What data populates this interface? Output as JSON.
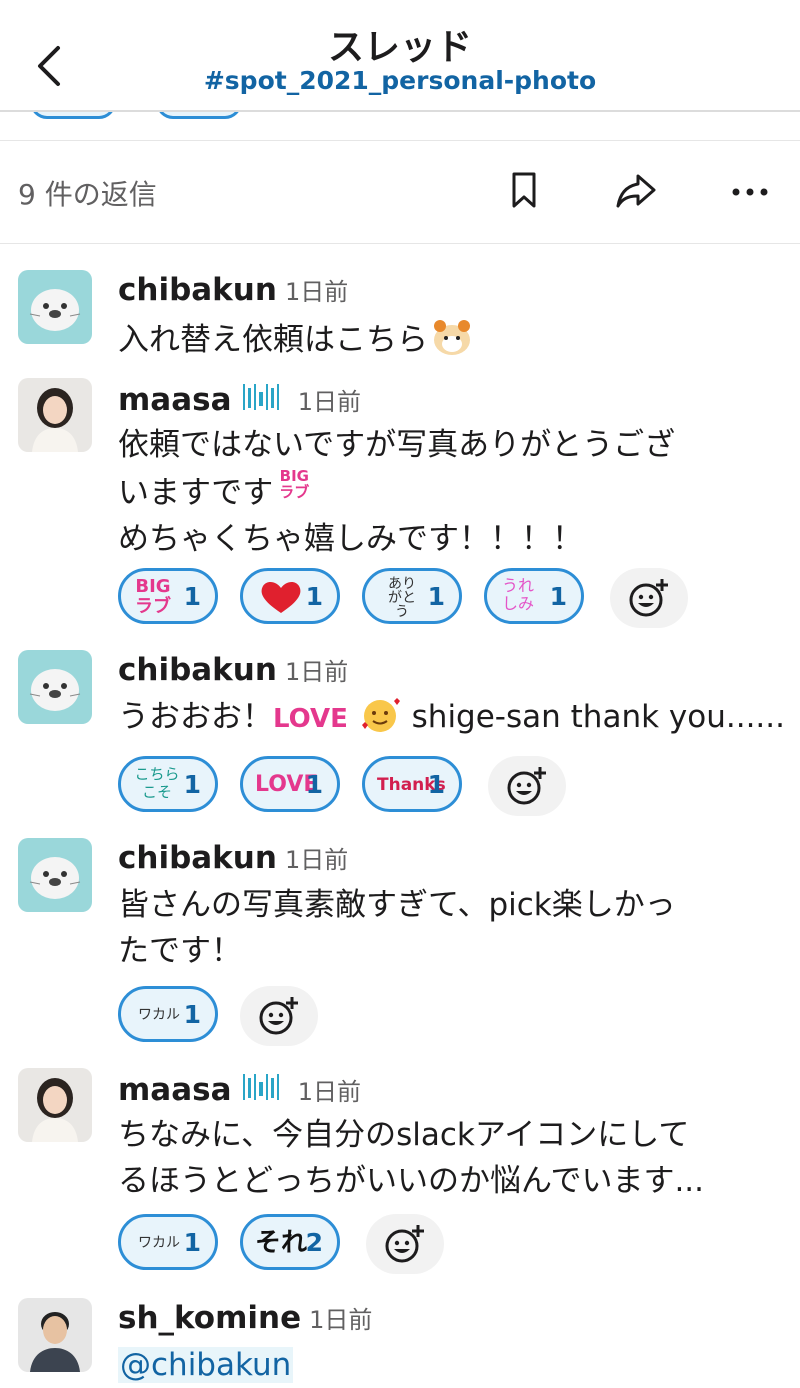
{
  "header": {
    "title": "スレッド",
    "channel": "#spot_2021_personal-photo",
    "back_icon": "chevron-left-icon"
  },
  "thread_bar": {
    "replies_label": "9 件の返信",
    "icons": [
      "bookmark-icon",
      "share-icon",
      "more-icon"
    ]
  },
  "messages": [
    {
      "user": "chibakun",
      "time": "1日前",
      "text": "入れ替え依頼はこちら"
    },
    {
      "user": "maasa",
      "time": "1日前",
      "status_emoji": "barcode-status-icon",
      "lines": [
        "依頼ではないですが写真ありがとうござ",
        "いますです",
        "めちゃくちゃ嬉しみです！！！！"
      ],
      "inline_emoji_text": "BIGラブ",
      "reactions": [
        {
          "emoji": "BIGラブ",
          "count": "1"
        },
        {
          "emoji": "heart-icon",
          "count": "1"
        },
        {
          "emoji": "ありがとう",
          "count": "1"
        },
        {
          "emoji": "うれしみ",
          "count": "1"
        }
      ]
    },
    {
      "user": "chibakun",
      "time": "1日前",
      "text_a": "うおおお！",
      "inline_emoji_text": "LOVE",
      "text_b": " shige-san thank you......",
      "reactions": [
        {
          "emoji": "こちらこそ",
          "count": "1"
        },
        {
          "emoji": "LOVE",
          "count": "1"
        },
        {
          "emoji": "Thanks",
          "count": "1"
        }
      ]
    },
    {
      "user": "chibakun",
      "time": "1日前",
      "lines": [
        "皆さんの写真素敵すぎて、pick楽しかっ",
        "たです！"
      ],
      "reactions": [
        {
          "emoji": "ワカル",
          "count": "1"
        }
      ]
    },
    {
      "user": "maasa",
      "time": "1日前",
      "status_emoji": "barcode-status-icon",
      "lines": [
        "ちなみに、今自分のslackアイコンにして",
        "るほうとどっちがいいのか悩んでいます..."
      ],
      "reactions": [
        {
          "emoji": "ワカル",
          "count": "1"
        },
        {
          "emoji": "それ",
          "count": "2"
        }
      ]
    },
    {
      "user": "sh_komine",
      "time": "1日前",
      "mention": "@chibakun"
    }
  ]
}
